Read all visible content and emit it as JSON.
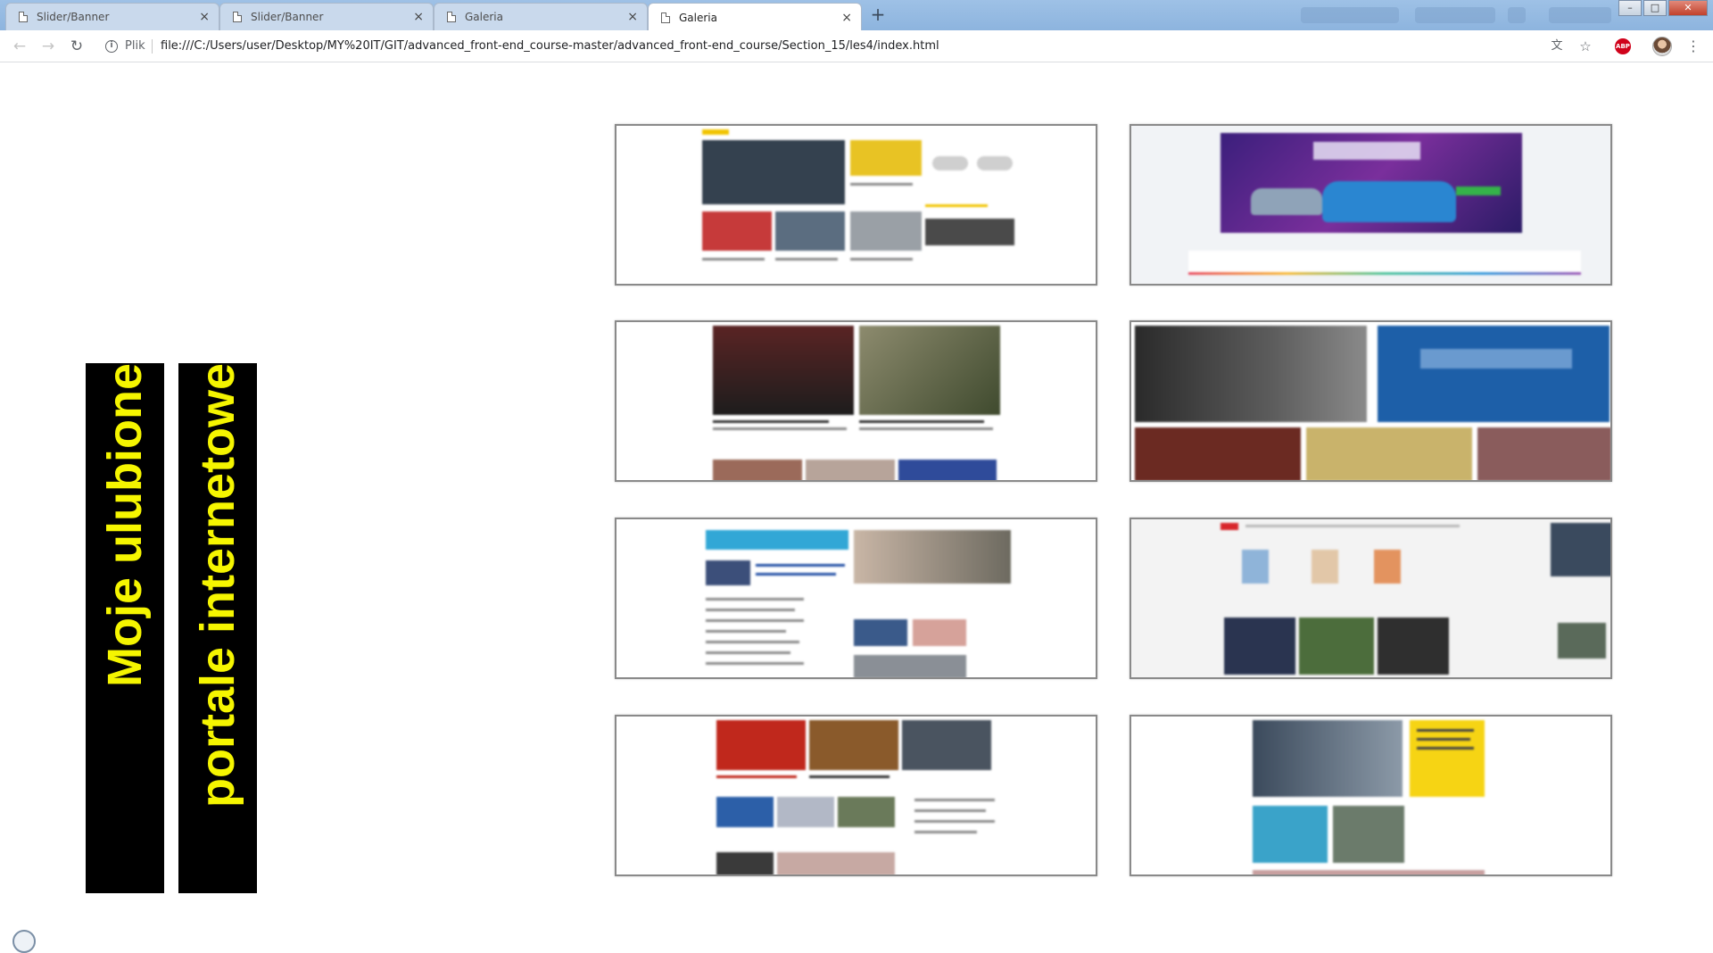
{
  "browser": {
    "tabs": [
      {
        "title": "Slider/Banner",
        "active": false
      },
      {
        "title": "Slider/Banner",
        "active": false
      },
      {
        "title": "Galeria",
        "active": false
      },
      {
        "title": "Galeria",
        "active": true
      }
    ],
    "tab_close_glyph": "×",
    "new_tab_glyph": "+",
    "window_controls": [
      "–",
      "□",
      "✕"
    ],
    "address_bar": {
      "scheme_label": "Plik",
      "url": "file:///C:/Users/user/Desktop/MY%20IT/GIT/advanced_front-end_course-master/advanced_front-end_course/Section_15/les4/index.html"
    },
    "toolbar_icons": [
      "back-icon",
      "forward-icon",
      "reload-icon",
      "info-icon",
      "translate-icon",
      "star-icon",
      "adblock-plus-icon",
      "profile-avatar",
      "menu-icon"
    ],
    "adblock_text": "ABP"
  },
  "page": {
    "heading_line_1": "Moje ulubione",
    "heading_line_2": "portale internetowe",
    "gallery": [
      {
        "name": "portal-news-1",
        "accent": "#f1c400"
      },
      {
        "name": "portal-sale-banner",
        "accent": "#4b2a8c"
      },
      {
        "name": "portal-news-2",
        "accent": "#3a3a3a"
      },
      {
        "name": "portal-tech",
        "accent": "#1d5fa8"
      },
      {
        "name": "portal-weather-news",
        "accent": "#32a7d6"
      },
      {
        "name": "portal-wp",
        "accent": "#d8262b"
      },
      {
        "name": "portal-news-red",
        "accent": "#c0281c"
      },
      {
        "name": "portal-tabloid",
        "accent": "#f6d414"
      }
    ],
    "colors": {
      "label_background": "#000000",
      "label_text": "#f5f500"
    }
  }
}
